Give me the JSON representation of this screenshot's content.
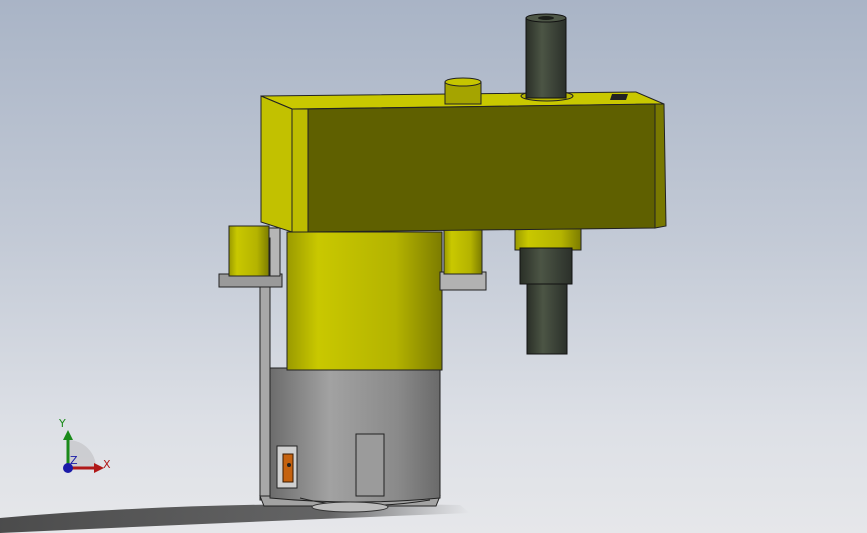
{
  "viewport": {
    "background_top": "#a9b4c6",
    "background_bottom": "#e6e7ea"
  },
  "model": {
    "housing_color": "#c8c700",
    "housing_shadow_color": "#5e5f00",
    "motor_can_color": "#8c8c8c",
    "shaft_color": "#3d4438",
    "bracket_color": "#a0a0a0",
    "terminal_color": "#c5620f"
  },
  "triad": {
    "x_label": "X",
    "y_label": "Y",
    "z_label": "Z",
    "x_color": "#b01818",
    "y_color": "#1a8a1a",
    "z_color": "#1a1aa8"
  }
}
